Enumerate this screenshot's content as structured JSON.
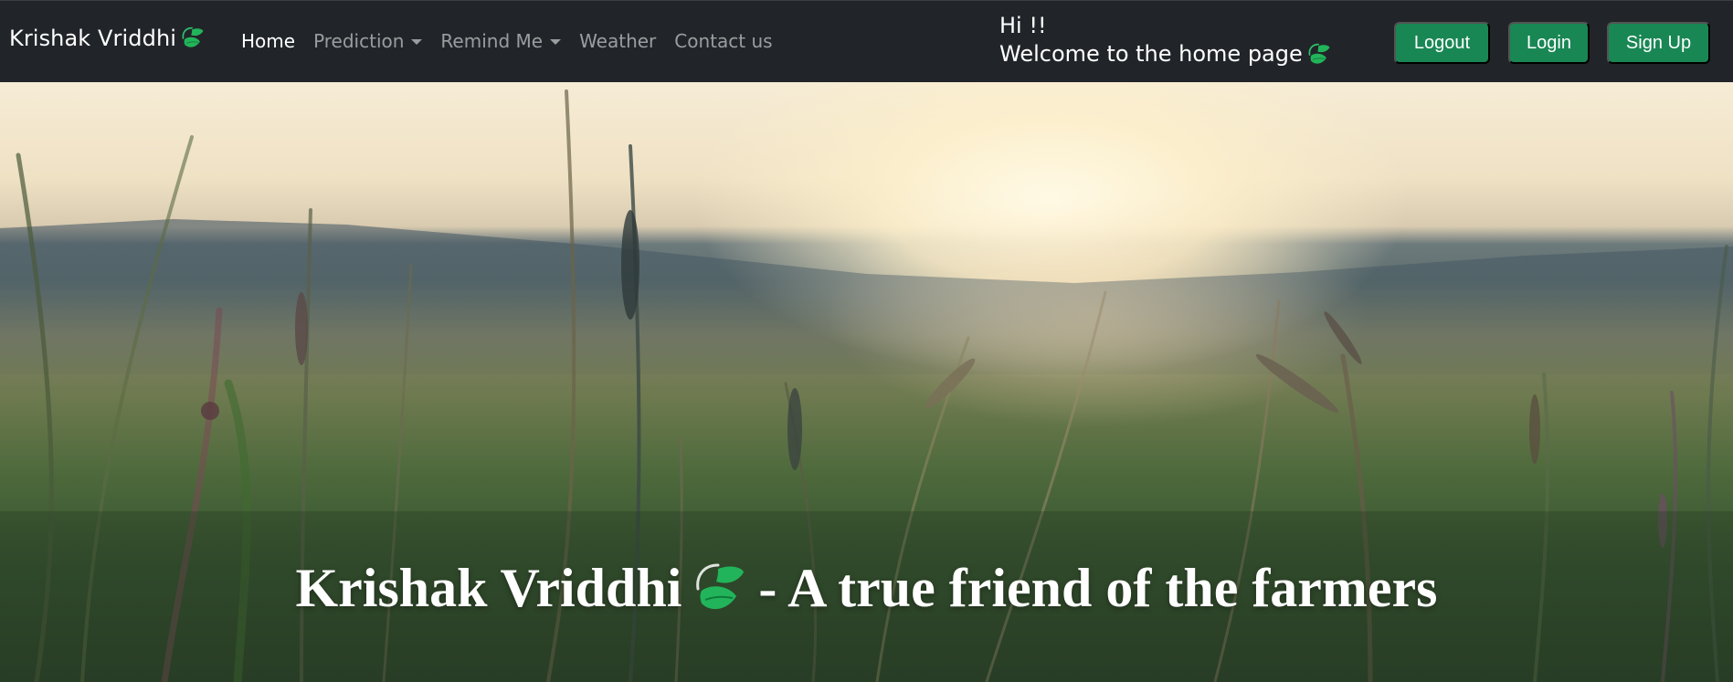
{
  "navbar": {
    "brand": "Krishak Vriddhi",
    "brand_icon": "leaf-icon",
    "links": [
      {
        "label": "Home",
        "active": true,
        "dropdown": false
      },
      {
        "label": "Prediction",
        "active": false,
        "dropdown": true
      },
      {
        "label": "Remind Me",
        "active": false,
        "dropdown": true
      },
      {
        "label": "Weather",
        "active": false,
        "dropdown": false
      },
      {
        "label": "Contact us",
        "active": false,
        "dropdown": false
      }
    ],
    "greeting_line1": "Hi !!",
    "greeting_line2": "Welcome to the home page",
    "buttons": {
      "logout": "Logout",
      "login": "Login",
      "signup": "Sign Up"
    },
    "colors": {
      "background": "#212529",
      "button": "#198754",
      "leaf": "#22b45a"
    }
  },
  "hero": {
    "title_part1": "Krishak Vriddhi",
    "title_part2": "- A true friend of the farmers",
    "title_icon": "leaf-icon",
    "background_image": "grass field at sunrise"
  }
}
